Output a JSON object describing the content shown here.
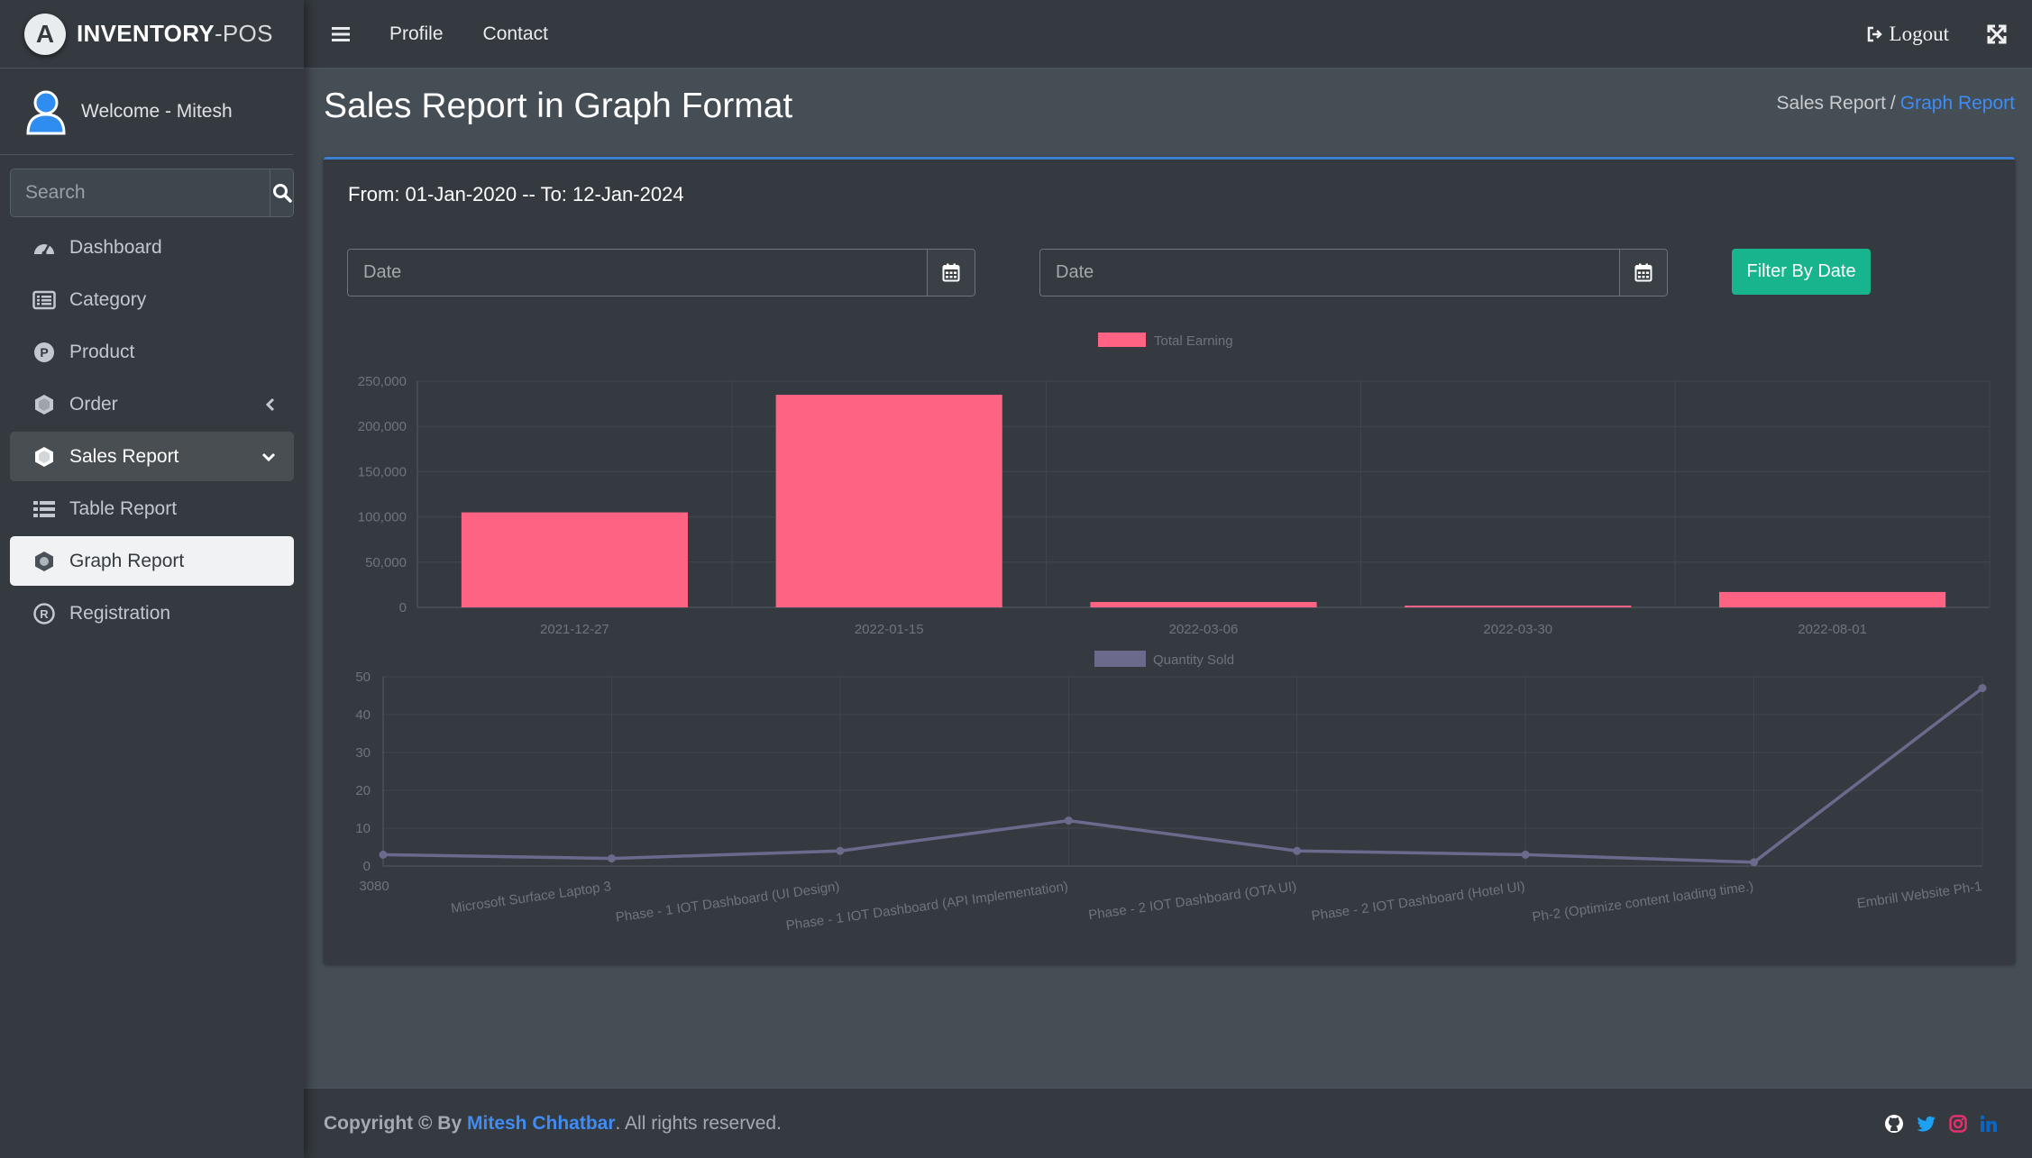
{
  "brand": {
    "name_bold": "INVENTORY",
    "name_rest": "-POS",
    "logo_letter": "A"
  },
  "user": {
    "welcome": "Welcome - Mitesh"
  },
  "search": {
    "placeholder": "Search"
  },
  "sidebar": {
    "items": [
      {
        "label": "Dashboard",
        "icon": "tachometer-icon"
      },
      {
        "label": "Category",
        "icon": "list-alt-icon"
      },
      {
        "label": "Product",
        "icon": "product-p-icon"
      },
      {
        "label": "Order",
        "icon": "hexagon-icon"
      },
      {
        "label": "Sales Report",
        "icon": "hexagon-icon"
      },
      {
        "label": "Table Report",
        "icon": "list-icon"
      },
      {
        "label": "Graph Report",
        "icon": "gear-hexagon-icon"
      },
      {
        "label": "Registration",
        "icon": "registered-icon"
      }
    ]
  },
  "topnav": {
    "profile": "Profile",
    "contact": "Contact",
    "logout": "Logout"
  },
  "page": {
    "title": "Sales Report in Graph Format",
    "breadcrumb_parent": "Sales Report",
    "breadcrumb_sep": "/",
    "breadcrumb_active": "Graph Report"
  },
  "filter": {
    "range_text": "From: 01-Jan-2020 -- To: 12-Jan-2024",
    "from_placeholder": "Date",
    "to_placeholder": "Date",
    "button_label": "Filter By Date"
  },
  "chart_data": [
    {
      "type": "bar",
      "series": [
        {
          "name": "Total Earning",
          "color": "#ff6384",
          "values": [
            105000,
            235000,
            6000,
            2000,
            17000
          ]
        }
      ],
      "categories": [
        "2021-12-27",
        "2022-01-15",
        "2022-03-06",
        "2022-03-30",
        "2022-08-01"
      ],
      "y_ticks": [
        "0",
        "50,000",
        "100,000",
        "150,000",
        "200,000",
        "250,000"
      ],
      "ylim": [
        0,
        250000
      ],
      "legend_position": "top-center",
      "grid": true
    },
    {
      "type": "line",
      "series": [
        {
          "name": "Quantity Sold",
          "color": "#6c6a8c",
          "values": [
            3,
            2,
            4,
            12,
            4,
            3,
            1,
            47
          ]
        }
      ],
      "categories": [
        "3080",
        "Microsoft Surface Laptop 3",
        "Phase - 1 IOT Dashboard (UI Design)",
        "Phase - 1 IOT Dashboard (API Implementation)",
        "Phase - 2 IOT Dashboard (OTA UI)",
        "Phase - 2 IOT Dashboard (Hotel UI)",
        "Ph-2 (Optimize content loading time.)",
        "Embrill Website Ph-1"
      ],
      "y_ticks": [
        "0",
        "10",
        "20",
        "30",
        "40",
        "50"
      ],
      "ylim": [
        0,
        50
      ],
      "legend_position": "top-center",
      "grid": true
    }
  ],
  "footer": {
    "copyright_prefix": "Copyright © By",
    "author": "Mitesh Chhatbar",
    "suffix": ". All rights reserved.",
    "social_colors": {
      "github": "#ffffff",
      "twitter": "#1da1f2",
      "instagram": "#e1306c",
      "linkedin": "#0a66c2"
    }
  }
}
